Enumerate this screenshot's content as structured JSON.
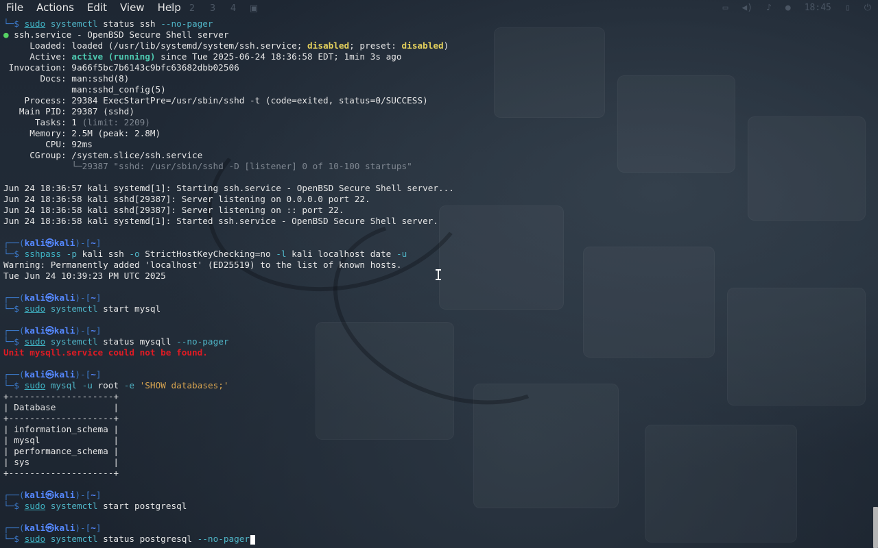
{
  "menu": [
    "File",
    "Actions",
    "Edit",
    "View",
    "Help"
  ],
  "panel": {
    "workspaces": [
      "1",
      "2",
      "3",
      "4"
    ],
    "clock": "18:45"
  },
  "terminal": {
    "lines": [
      [
        [
          "c-box",
          "└─$ "
        ],
        [
          "c-ul",
          "sudo"
        ],
        [
          "c-param",
          " systemctl"
        ],
        [
          "c-default",
          " status ssh "
        ],
        [
          "c-param",
          "--no-pager"
        ]
      ],
      [
        [
          "c-dot",
          "● "
        ],
        [
          "c-default",
          "ssh.service - OpenBSD Secure Shell server"
        ]
      ],
      [
        [
          "c-default",
          "     Loaded: loaded (/usr/lib/systemd/system/ssh.service; "
        ],
        [
          "c-yellow",
          "disabled"
        ],
        [
          "c-default",
          "; preset: "
        ],
        [
          "c-yellow",
          "disabled"
        ],
        [
          "c-default",
          ")"
        ]
      ],
      [
        [
          "c-default",
          "     Active: "
        ],
        [
          "c-green",
          "active (running)"
        ],
        [
          "c-default",
          " since Tue 2025-06-24 18:36:58 EDT; 1min 3s ago"
        ]
      ],
      [
        [
          "c-default",
          " Invocation: 9a66f5bc7b6143c9bfc63682dbb02506"
        ]
      ],
      [
        [
          "c-default",
          "       Docs: man:sshd(8)"
        ]
      ],
      [
        [
          "c-default",
          "             man:sshd_config(5)"
        ]
      ],
      [
        [
          "c-default",
          "    Process: 29384 ExecStartPre=/usr/sbin/sshd -t (code=exited, status=0/SUCCESS)"
        ]
      ],
      [
        [
          "c-default",
          "   Main PID: 29387 (sshd)"
        ]
      ],
      [
        [
          "c-default",
          "      Tasks: 1 "
        ],
        [
          "c-gray",
          "(limit: 2209)"
        ]
      ],
      [
        [
          "c-default",
          "     Memory: 2.5M (peak: 2.8M)"
        ]
      ],
      [
        [
          "c-default",
          "        CPU: 92ms"
        ]
      ],
      [
        [
          "c-default",
          "     CGroup: /system.slice/ssh.service"
        ]
      ],
      [
        [
          "c-gray",
          "             └─29387 \"sshd: /usr/sbin/sshd -D [listener] 0 of 10-100 startups\""
        ]
      ],
      [],
      [
        [
          "c-default",
          "Jun 24 18:36:57 kali systemd[1]: Starting ssh.service - OpenBSD Secure Shell server..."
        ]
      ],
      [
        [
          "c-default",
          "Jun 24 18:36:58 kali sshd[29387]: Server listening on 0.0.0.0 port 22."
        ]
      ],
      [
        [
          "c-default",
          "Jun 24 18:36:58 kali sshd[29387]: Server listening on :: port 22."
        ]
      ],
      [
        [
          "c-default",
          "Jun 24 18:36:58 kali systemd[1]: Started ssh.service - OpenBSD Secure Shell server."
        ]
      ],
      [],
      [
        [
          "c-box",
          "┌──("
        ],
        [
          "c-user",
          "kali㉿kali"
        ],
        [
          "c-box",
          ")-["
        ],
        [
          "c-user",
          "~"
        ],
        [
          "c-box",
          "]"
        ]
      ],
      [
        [
          "c-box",
          "└─$ "
        ],
        [
          "c-cyan",
          "sshpass"
        ],
        [
          "c-param",
          " -p"
        ],
        [
          "c-default",
          " kali ssh "
        ],
        [
          "c-param",
          "-o"
        ],
        [
          "c-default",
          " StrictHostKeyChecking=no "
        ],
        [
          "c-param",
          "-l"
        ],
        [
          "c-default",
          " kali localhost date "
        ],
        [
          "c-param",
          "-u"
        ]
      ],
      [
        [
          "c-default",
          "Warning: Permanently added 'localhost' (ED25519) to the list of known hosts."
        ]
      ],
      [
        [
          "c-default",
          "Tue Jun 24 10:39:23 PM UTC 2025"
        ]
      ],
      [],
      [
        [
          "c-box",
          "┌──("
        ],
        [
          "c-user",
          "kali㉿kali"
        ],
        [
          "c-box",
          ")-["
        ],
        [
          "c-user",
          "~"
        ],
        [
          "c-box",
          "]"
        ]
      ],
      [
        [
          "c-box",
          "└─$ "
        ],
        [
          "c-ul",
          "sudo"
        ],
        [
          "c-param",
          " systemctl"
        ],
        [
          "c-default",
          " start mysql"
        ]
      ],
      [],
      [
        [
          "c-box",
          "┌──("
        ],
        [
          "c-user",
          "kali㉿kali"
        ],
        [
          "c-box",
          ")-["
        ],
        [
          "c-user",
          "~"
        ],
        [
          "c-box",
          "]"
        ]
      ],
      [
        [
          "c-box",
          "└─$ "
        ],
        [
          "c-ul",
          "sudo"
        ],
        [
          "c-param",
          " systemctl"
        ],
        [
          "c-default",
          " status mysqll "
        ],
        [
          "c-param",
          "--no-pager"
        ]
      ],
      [
        [
          "c-red",
          "Unit mysqll.service could not be found."
        ]
      ],
      [],
      [
        [
          "c-box",
          "┌──("
        ],
        [
          "c-user",
          "kali㉿kali"
        ],
        [
          "c-box",
          ")-["
        ],
        [
          "c-user",
          "~"
        ],
        [
          "c-box",
          "]"
        ]
      ],
      [
        [
          "c-box",
          "└─$ "
        ],
        [
          "c-ul",
          "sudo"
        ],
        [
          "c-param",
          " mysql"
        ],
        [
          "c-param",
          " -u"
        ],
        [
          "c-default",
          " root "
        ],
        [
          "c-param",
          "-e"
        ],
        [
          "c-str",
          " 'SHOW databases;'"
        ]
      ],
      [
        [
          "c-default",
          "+--------------------+"
        ]
      ],
      [
        [
          "c-default",
          "| Database           |"
        ]
      ],
      [
        [
          "c-default",
          "+--------------------+"
        ]
      ],
      [
        [
          "c-default",
          "| information_schema |"
        ]
      ],
      [
        [
          "c-default",
          "| mysql              |"
        ]
      ],
      [
        [
          "c-default",
          "| performance_schema |"
        ]
      ],
      [
        [
          "c-default",
          "| sys                |"
        ]
      ],
      [
        [
          "c-default",
          "+--------------------+"
        ]
      ],
      [],
      [
        [
          "c-box",
          "┌──("
        ],
        [
          "c-user",
          "kali㉿kali"
        ],
        [
          "c-box",
          ")-["
        ],
        [
          "c-user",
          "~"
        ],
        [
          "c-box",
          "]"
        ]
      ],
      [
        [
          "c-box",
          "└─$ "
        ],
        [
          "c-ul",
          "sudo"
        ],
        [
          "c-param",
          " systemctl"
        ],
        [
          "c-default",
          " start postgresql"
        ]
      ],
      [],
      [
        [
          "c-box",
          "┌──("
        ],
        [
          "c-user",
          "kali㉿kali"
        ],
        [
          "c-box",
          ")-["
        ],
        [
          "c-user",
          "~"
        ],
        [
          "c-box",
          "]"
        ]
      ],
      [
        [
          "c-box",
          "└─$ "
        ],
        [
          "c-ul",
          "sudo"
        ],
        [
          "c-param",
          " systemctl"
        ],
        [
          "c-default",
          " status postgresql "
        ],
        [
          "c-param",
          "--no-pager"
        ]
      ]
    ]
  }
}
